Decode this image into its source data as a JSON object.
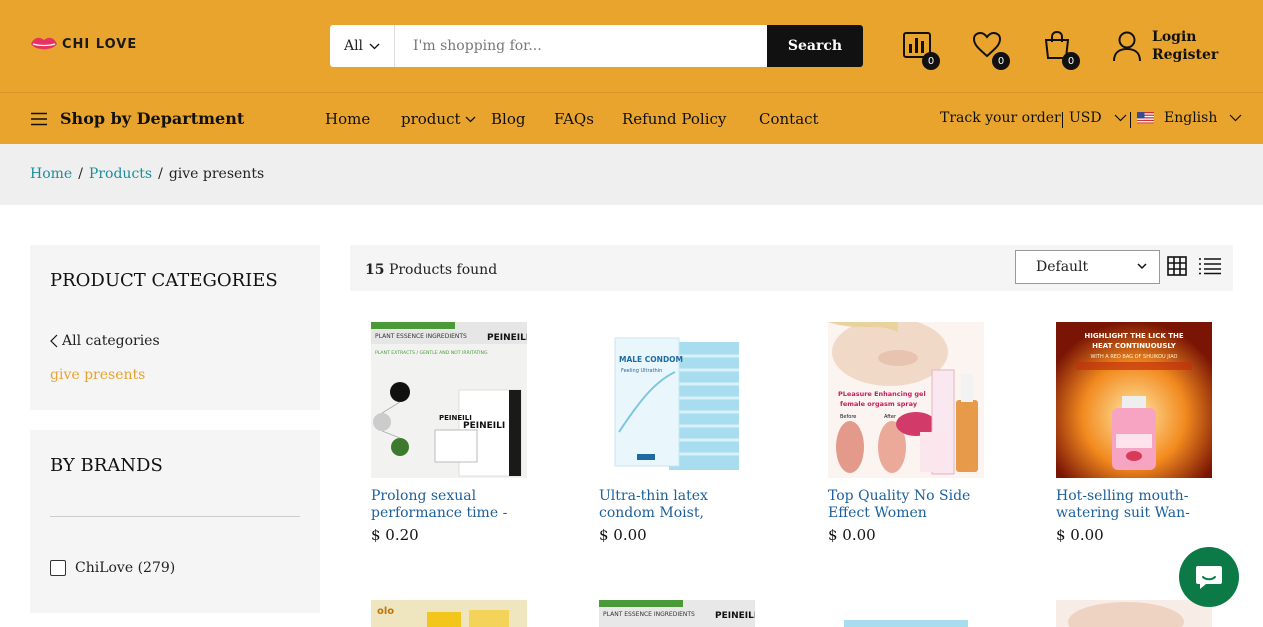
{
  "header": {
    "logo_text": "CHI LOVE",
    "search": {
      "category": "All",
      "placeholder": "I'm shopping for...",
      "button": "Search"
    },
    "compare_count": "0",
    "wishlist_count": "0",
    "cart_count": "0",
    "login": "Login",
    "register": "Register"
  },
  "nav": {
    "department": "Shop by Department",
    "items": [
      "Home",
      "product",
      "Blog",
      "FAQs",
      "Refund Policy",
      "Contact"
    ],
    "track": "Track your order",
    "currency": "USD",
    "language": "English"
  },
  "breadcrumb": {
    "home": "Home",
    "products": "Products",
    "current": "give presents"
  },
  "sidebar": {
    "categories_title": "PRODUCT CATEGORIES",
    "all_categories": "All categories",
    "current_category": "give presents",
    "brands_title": "BY BRANDS",
    "brand": "ChiLove (279)"
  },
  "toolbar": {
    "count": "15",
    "found_label": "Products found",
    "sort": "Default"
  },
  "products": [
    {
      "title": "Prolong sexual performance time -",
      "price": "$ 0.20"
    },
    {
      "title": "Ultra-thin latex condom Moist, tender",
      "price": "$ 0.00"
    },
    {
      "title": "Top Quality No Side Effect Women",
      "price": "$ 0.00"
    },
    {
      "title": "Hot-selling mouth-watering suit Wan-",
      "price": "$ 0.00"
    }
  ],
  "image_text": {
    "p1_brand": "PEINEILI",
    "p1_banner": "PLANT ESSENCE INGREDIENTS",
    "p1_tag": "PLANT EXTRACTS / GENTLE AND NOT IRRITATING",
    "p2_brand": "MALE CONDOM",
    "p2_sub": "Feeling Ultrathin",
    "p3_title": "PLeasure Enhancing gel",
    "p3_sub": "female orgasm spray",
    "p3_before": "Before",
    "p3_after": "After",
    "p4_line1": "HIGHLIGHT THE LICK THE",
    "p4_line2": "HEAT CONTINUOUSLY",
    "p4_line3": "WITH A RED BAG OF SHUIKOU JIAO",
    "r2_brand": "olo"
  },
  "colors": {
    "accent": "#e9a42e",
    "link": "#1c5f9c",
    "breadcrumb_link": "#1a8f9c",
    "chat": "#0b7a47"
  }
}
